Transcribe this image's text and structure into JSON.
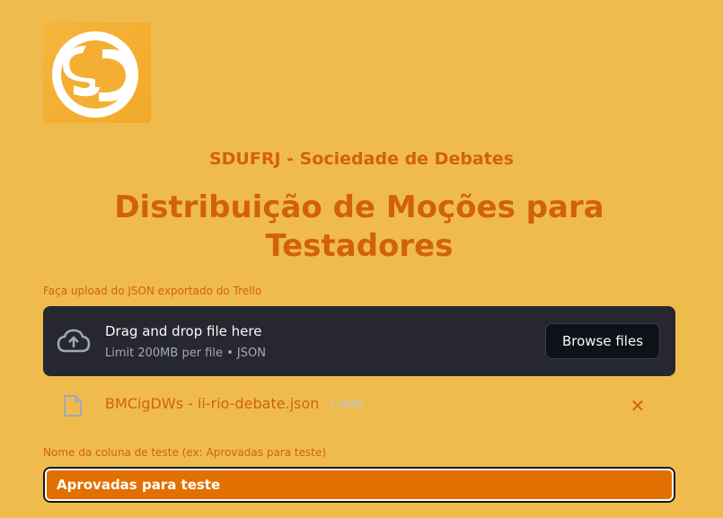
{
  "header": {
    "logo_text": "SD",
    "org_title": "SDUFRJ - Sociedade de Debates",
    "main_title_line1": "Distribuição de Moções para",
    "main_title_line2": "Testadores"
  },
  "uploader": {
    "label": "Faça upload do JSON exportado do Trello",
    "drop_title": "Drag and drop file here",
    "drop_limit": "Limit 200MB per file • JSON",
    "browse_label": "Browse files",
    "icon": "cloud-upload-icon"
  },
  "uploaded_file": {
    "name": "BMCigDWs - ii-rio-debate.json",
    "size": "1.6MB",
    "remove_symbol": "✕",
    "icon": "file-icon"
  },
  "column_field": {
    "label": "Nome da coluna de teste (ex: Aprovadas para teste)",
    "value": "Aprovadas para teste"
  },
  "colors": {
    "background": "#F0BB4D",
    "accent": "#D2620A",
    "dropzone": "#262730",
    "input_fill": "#E17000"
  }
}
